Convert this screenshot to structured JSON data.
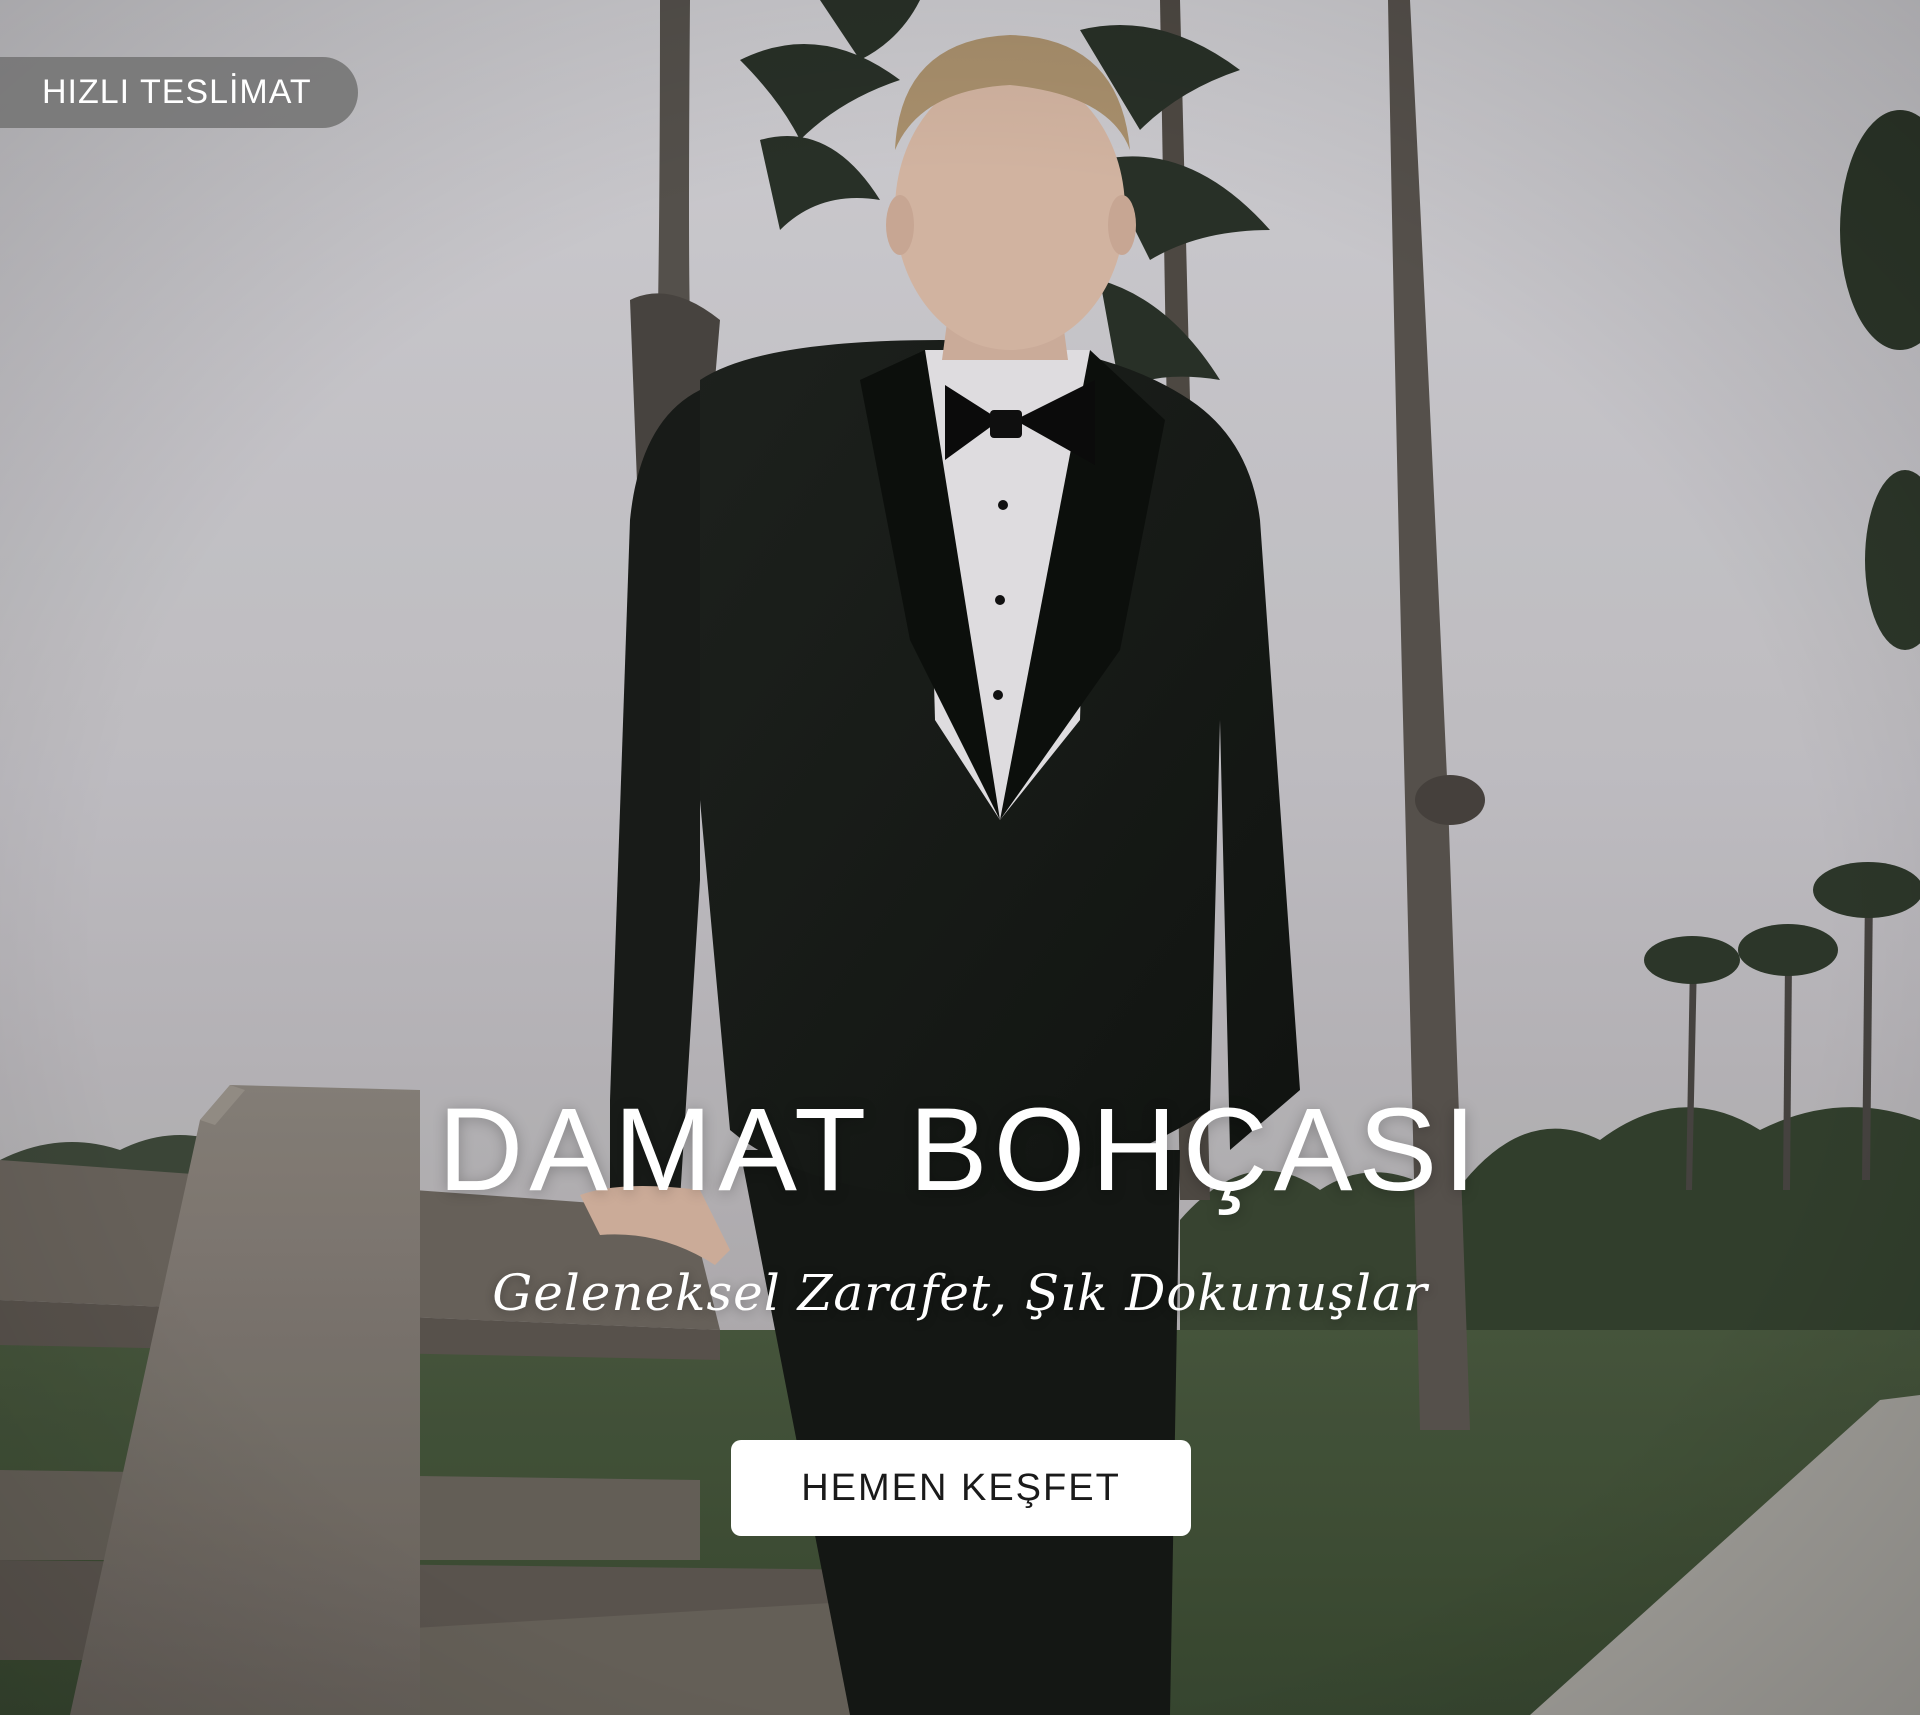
{
  "badge": {
    "label": "HIZLI TESLİMAT"
  },
  "hero": {
    "title": "DAMAT BOHÇASI",
    "subtitle": "Geleneksel Zarafet, Şık Dokunuşlar",
    "cta_label": "HEMEN KEŞFET"
  },
  "colors": {
    "text": "#ffffff",
    "button_bg": "#ffffff",
    "button_text": "#1a1a1a",
    "badge_bg": "#767676"
  }
}
